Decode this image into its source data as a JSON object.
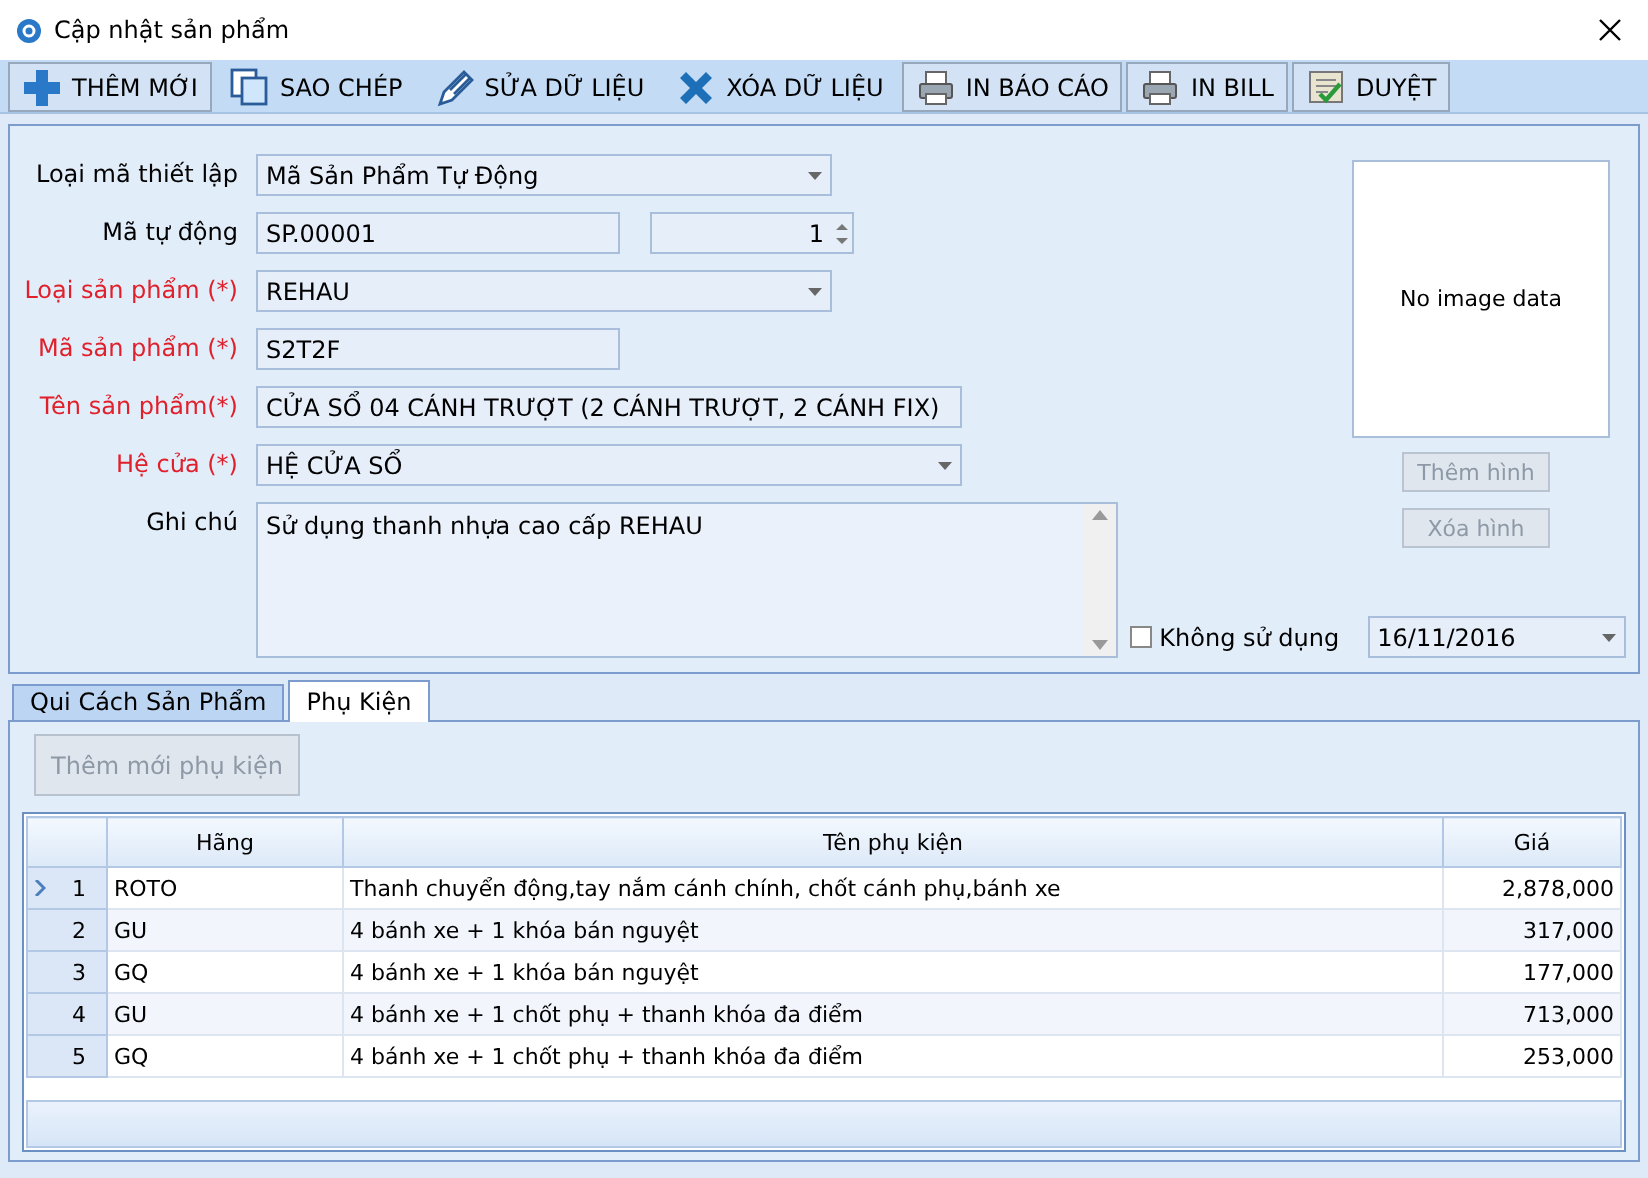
{
  "window": {
    "title": "Cập nhật sản phẩm"
  },
  "toolbar": {
    "buttons": [
      {
        "label": "THÊM MỚI",
        "kind": "add",
        "raised": true
      },
      {
        "label": "SAO CHÉP",
        "kind": "copy",
        "raised": false
      },
      {
        "label": "SỬA DỮ LIỆU",
        "kind": "edit",
        "raised": false
      },
      {
        "label": "XÓA DỮ LIỆU",
        "kind": "delete",
        "raised": false
      },
      {
        "label": "IN BÁO CÁO",
        "kind": "print",
        "raised": true
      },
      {
        "label": "IN BILL",
        "kind": "print",
        "raised": true
      },
      {
        "label": "DUYỆT",
        "kind": "approve",
        "raised": true
      }
    ]
  },
  "form": {
    "fields": [
      {
        "label": "Loại mã thiết lập",
        "required": false,
        "kind": "combo",
        "value": "Mã Sản Phẩm Tự Động"
      },
      {
        "label": "Mã tự động",
        "required": false,
        "kind": "code",
        "value": "SP.00001",
        "counter": "1"
      },
      {
        "label": "Loại sản phẩm (*)",
        "required": true,
        "kind": "combo",
        "value": "REHAU"
      },
      {
        "label": "Mã sản phẩm (*)",
        "required": true,
        "kind": "text",
        "value": "S2T2F"
      },
      {
        "label": "Tên sản phẩm(*)",
        "required": true,
        "kind": "text",
        "value": "CỬA SỔ 04 CÁNH TRƯỢT (2 CÁNH TRƯỢT, 2 CÁNH FIX)"
      },
      {
        "label": "Hệ cửa (*)",
        "required": true,
        "kind": "combo",
        "value": "HỆ CỬA SỔ"
      },
      {
        "label": "Ghi chú",
        "required": false,
        "kind": "memo",
        "value": "Sử dụng thanh nhựa cao cấp REHAU"
      }
    ],
    "image": {
      "text": "No image data",
      "buttons": [
        {
          "label": "Thêm hình",
          "disabled": true
        },
        {
          "label": "Xóa hình",
          "disabled": true
        }
      ]
    },
    "inactive": {
      "label": "Không sử dụng",
      "checked": false
    },
    "date": "16/11/2016"
  },
  "tabs": [
    {
      "label": "Qui Cách Sản Phẩm",
      "selected": false
    },
    {
      "label": "Phụ Kiện",
      "selected": true
    }
  ],
  "accessories": {
    "add_button": {
      "label": "Thêm mới phụ kiện",
      "disabled": true
    },
    "table": {
      "columns": [
        "Hãng",
        "Tên phụ kiện",
        "Giá"
      ],
      "rows": [
        {
          "number": "1",
          "selected": true,
          "cells": [
            "ROTO",
            "Thanh chuyển động,tay nắm cánh chính, chốt cánh phụ,bánh xe",
            "2,878,000"
          ]
        },
        {
          "number": "2",
          "selected": false,
          "cells": [
            "GU",
            "4 bánh xe +  1 khóa bán nguyệt",
            "317,000"
          ]
        },
        {
          "number": "3",
          "selected": false,
          "cells": [
            "GQ",
            "4 bánh xe +  1 khóa bán nguyệt",
            "177,000"
          ]
        },
        {
          "number": "4",
          "selected": false,
          "cells": [
            "GU",
            "4 bánh xe + 1 chốt phụ + thanh khóa đa điểm",
            "713,000"
          ]
        },
        {
          "number": "5",
          "selected": false,
          "cells": [
            "GQ",
            "4 bánh xe + 1 chốt phụ + thanh khóa đa điểm",
            "253,000"
          ]
        }
      ]
    }
  }
}
